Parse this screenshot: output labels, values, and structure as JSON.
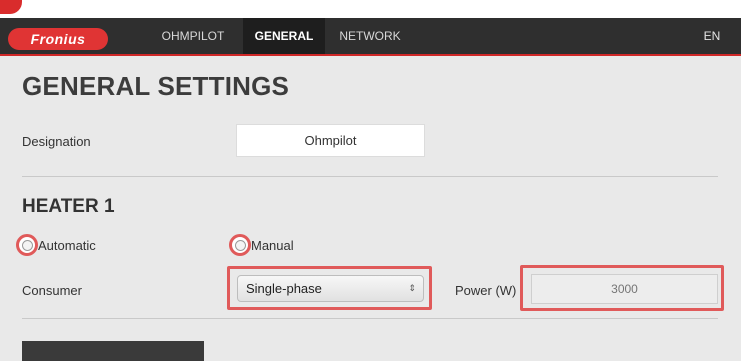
{
  "brand": {
    "logo_text": "Fronius"
  },
  "nav": {
    "items": [
      {
        "label": "OHMPILOT",
        "active": false
      },
      {
        "label": "GENERAL",
        "active": true
      },
      {
        "label": "NETWORK",
        "active": false
      }
    ],
    "language": "EN"
  },
  "page": {
    "title": "GENERAL SETTINGS"
  },
  "designation": {
    "label": "Designation",
    "value": "Ohmpilot"
  },
  "heater": {
    "title": "HEATER 1",
    "mode_options": [
      {
        "label": "Automatic",
        "selected": false
      },
      {
        "label": "Manual",
        "selected": false
      }
    ],
    "consumer": {
      "label": "Consumer",
      "selected": "Single-phase"
    },
    "power": {
      "label": "Power (W)",
      "placeholder": "3000"
    }
  },
  "colors": {
    "navbar": "#2f2f2f",
    "accent": "#d02828",
    "highlight": "#e05a5a",
    "background": "#e9e9e9"
  }
}
